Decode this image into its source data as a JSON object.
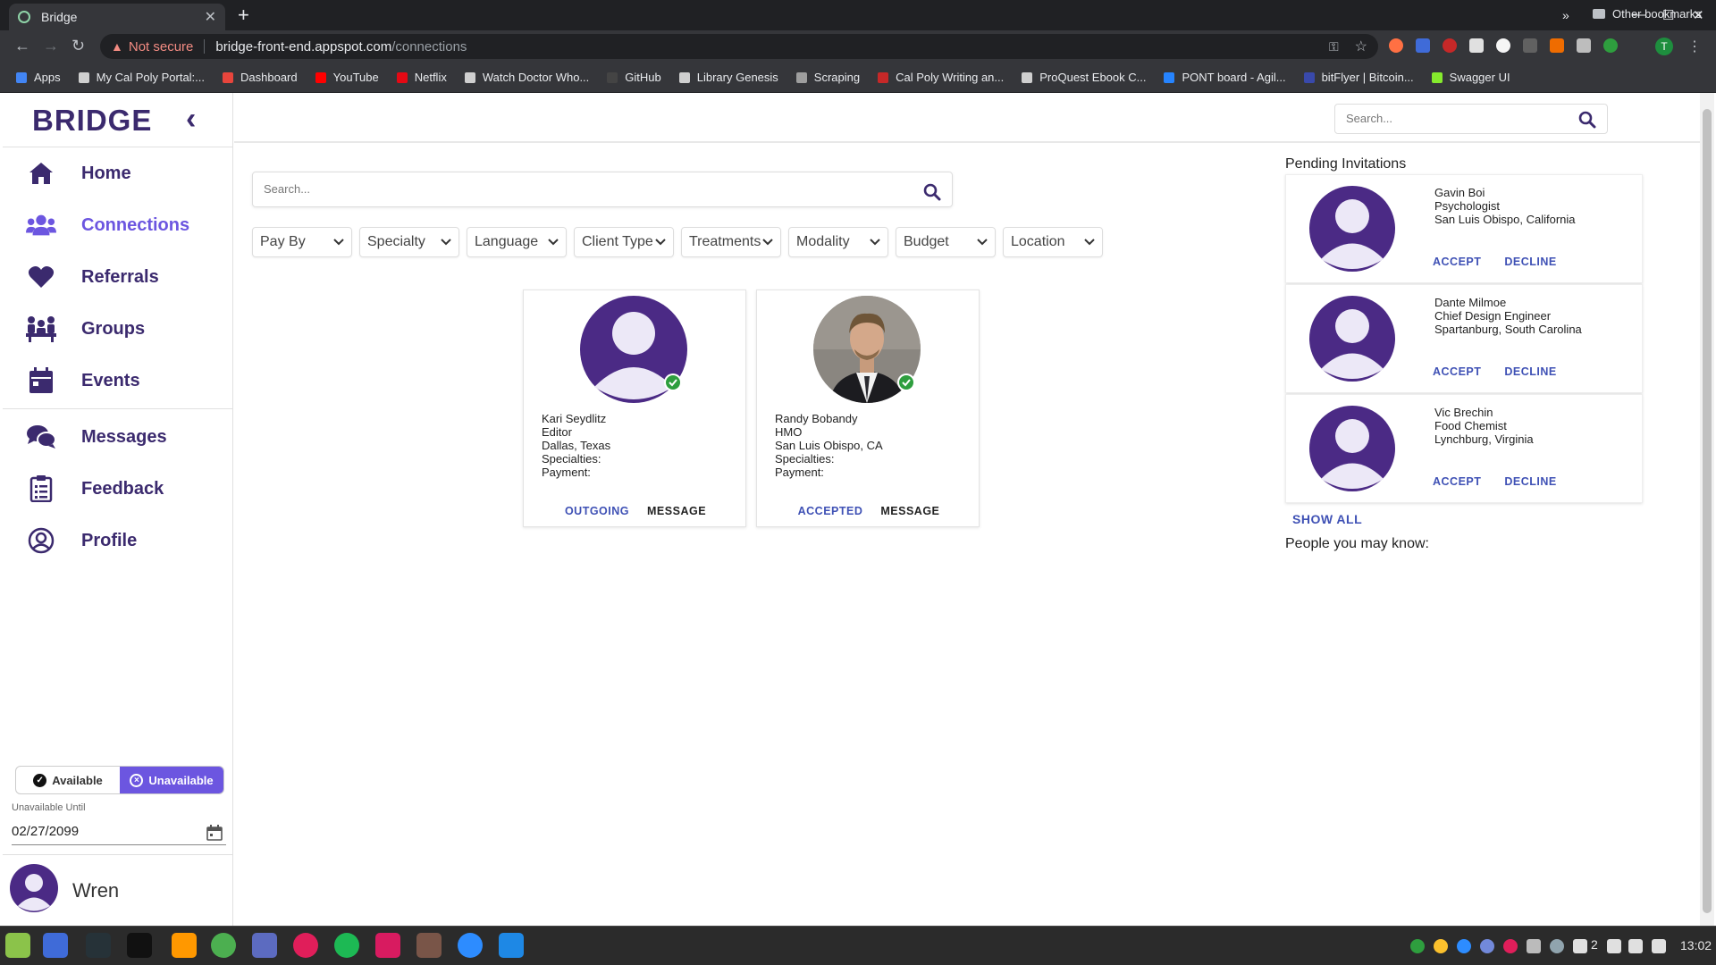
{
  "browser": {
    "tab_title": "Bridge",
    "url_warning": "Not secure",
    "url_host": "bridge-front-end.appspot.com",
    "url_path": "/connections",
    "profile_initial": "T",
    "bookmarks": [
      {
        "label": "Apps",
        "color": "#4285f4"
      },
      {
        "label": "My Cal Poly Portal:...",
        "color": "#cfcfcf"
      },
      {
        "label": "Dashboard",
        "color": "#e8453c"
      },
      {
        "label": "YouTube",
        "color": "#ff0000"
      },
      {
        "label": "Netflix",
        "color": "#e50914"
      },
      {
        "label": "Watch Doctor Who...",
        "color": "#cfcfcf"
      },
      {
        "label": "GitHub",
        "color": "#444444"
      },
      {
        "label": "Library Genesis",
        "color": "#cfcfcf"
      },
      {
        "label": "Scraping",
        "color": "#9e9e9e"
      },
      {
        "label": "Cal Poly Writing an...",
        "color": "#c62828"
      },
      {
        "label": "ProQuest Ebook C...",
        "color": "#cfcfcf"
      },
      {
        "label": "PONT board - Agil...",
        "color": "#2684ff"
      },
      {
        "label": "bitFlyer | Bitcoin...",
        "color": "#3949ab"
      },
      {
        "label": "Swagger UI",
        "color": "#85ea2d"
      }
    ],
    "bookmarks_more": "»",
    "other_bookmarks": "Other bookmarks"
  },
  "sidebar": {
    "brand": "BRIDGE",
    "nav": [
      {
        "label": "Home",
        "icon": "home-icon"
      },
      {
        "label": "Connections",
        "icon": "users-icon",
        "active": true
      },
      {
        "label": "Referrals",
        "icon": "heart-icon"
      },
      {
        "label": "Groups",
        "icon": "group-icon"
      },
      {
        "label": "Events",
        "icon": "calendar-icon"
      },
      {
        "label": "Messages",
        "icon": "chat-icon"
      },
      {
        "label": "Feedback",
        "icon": "clipboard-icon"
      },
      {
        "label": "Profile",
        "icon": "user-circle-icon"
      }
    ],
    "available_label": "Available",
    "unavailable_label": "Unavailable",
    "unavailable_until_label": "Unavailable Until",
    "unavailable_until_value": "02/27/2099",
    "user_name": "Wren"
  },
  "header": {
    "search_placeholder": "Search..."
  },
  "main": {
    "search_placeholder": "Search...",
    "filters": [
      "Pay By",
      "Specialty",
      "Language",
      "Client Type",
      "Treatments",
      "Modality",
      "Budget",
      "Location"
    ],
    "connections": [
      {
        "name": "Kari Seydlitz",
        "title": "Editor",
        "location": "Dallas, Texas",
        "specialties": "Specialties:",
        "payment": "Payment:",
        "status": "OUTGOING",
        "message": "MESSAGE",
        "photo": false
      },
      {
        "name": "Randy Bobandy",
        "title": "HMO",
        "location": "San Luis Obispo, CA",
        "specialties": "Specialties:",
        "payment": "Payment:",
        "status": "ACCEPTED",
        "message": "MESSAGE",
        "photo": true
      }
    ]
  },
  "pending": {
    "title": "Pending Invitations",
    "invitations": [
      {
        "name": "Gavin Boi",
        "title": "Psychologist",
        "location": "San Luis Obispo, California",
        "accept": "ACCEPT",
        "decline": "DECLINE"
      },
      {
        "name": "Dante Milmoe",
        "title": "Chief Design Engineer",
        "location": "Spartanburg, South Carolina",
        "accept": "ACCEPT",
        "decline": "DECLINE"
      },
      {
        "name": "Vic Brechin",
        "title": "Food Chemist",
        "location": "Lynchburg, Virginia",
        "accept": "ACCEPT",
        "decline": "DECLINE"
      }
    ],
    "show_all": "SHOW ALL",
    "people_you_may_know": "People you may know:"
  },
  "taskbar": {
    "clock": "13:02",
    "workspace_count": "2"
  },
  "colors": {
    "brand": "#3b2a6e",
    "accent": "#6c56e0",
    "link": "#3f51b5",
    "avatar_bg": "#4b2a85",
    "avatar_fg": "#ece8f7",
    "online_badge": "#2e9e3e"
  }
}
